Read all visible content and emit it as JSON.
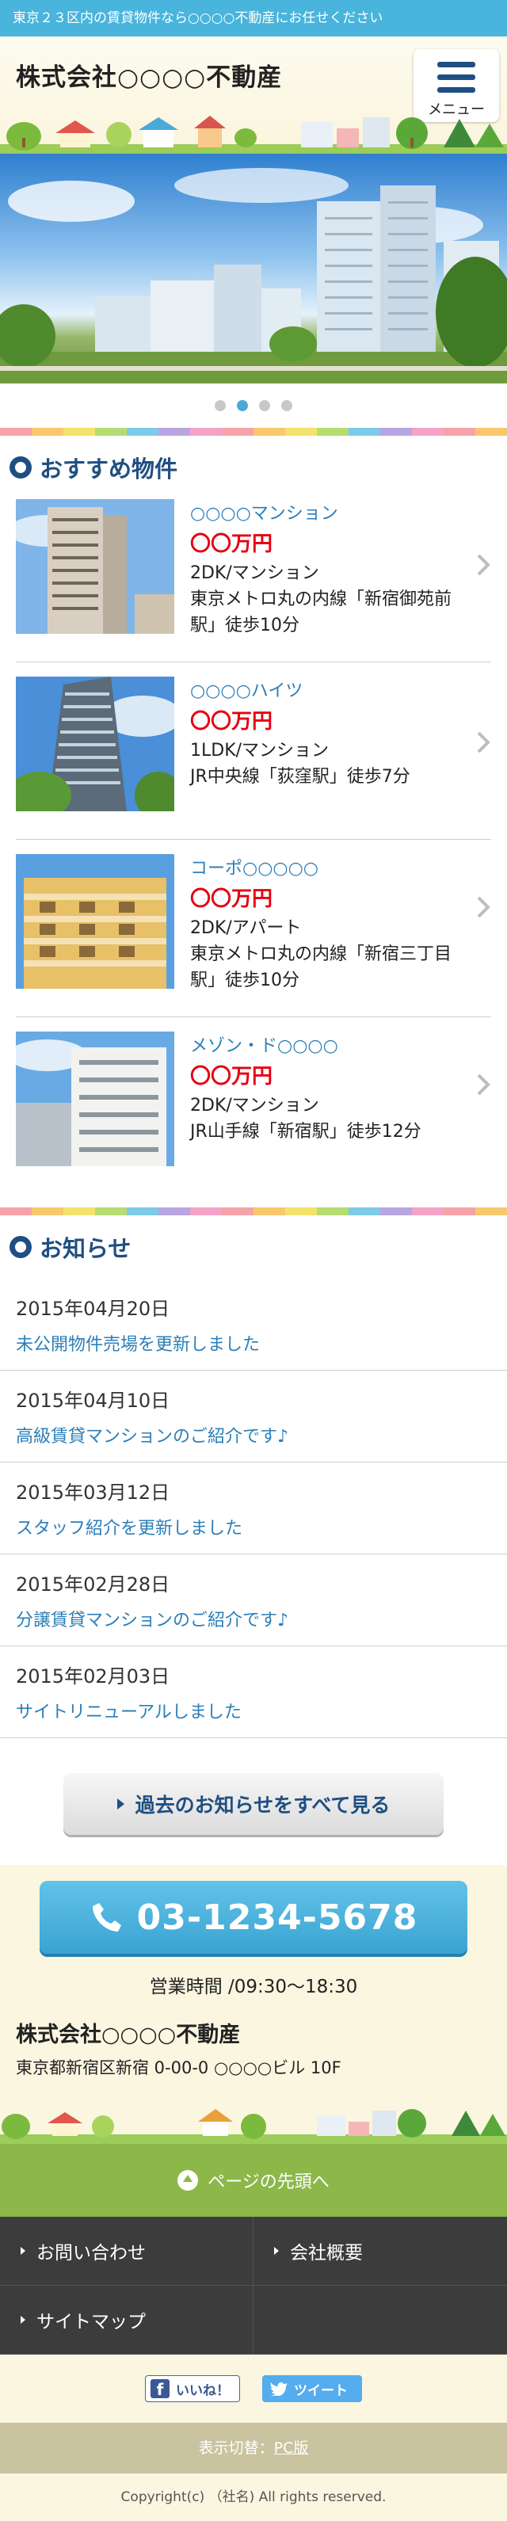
{
  "tagline": "東京２３区内の賃貸物件なら○○○○不動産にお任せください",
  "header": {
    "site_name": "株式会社○○○○不動産",
    "menu_label": "メニュー"
  },
  "slider": {
    "slide_count": 4,
    "active_index": 1
  },
  "recommended": {
    "title": "おすすめ物件",
    "items": [
      {
        "name": "○○○○マンション",
        "price": "〇〇万円",
        "type": "2DK/マンション",
        "access": "東京メトロ丸の内線「新宿御苑前駅」徒歩10分"
      },
      {
        "name": "○○○○ハイツ",
        "price": "〇〇万円",
        "type": "1LDK/マンション",
        "access": "JR中央線「荻窪駅」徒歩7分"
      },
      {
        "name": "コーポ○○○○○",
        "price": "〇〇万円",
        "type": "2DK/アパート",
        "access": "東京メトロ丸の内線「新宿三丁目駅」徒歩10分"
      },
      {
        "name": "メゾン・ド○○○○",
        "price": "〇〇万円",
        "type": "2DK/マンション",
        "access": "JR山手線「新宿駅」徒歩12分"
      }
    ]
  },
  "news": {
    "title": "お知らせ",
    "items": [
      {
        "date": "2015年04月20日",
        "text": "未公開物件売場を更新しました"
      },
      {
        "date": "2015年04月10日",
        "text": "高級賃貸マンションのご紹介です♪"
      },
      {
        "date": "2015年03月12日",
        "text": "スタッフ紹介を更新しました"
      },
      {
        "date": "2015年02月28日",
        "text": "分譲賃貸マンションのご紹介です♪"
      },
      {
        "date": "2015年02月03日",
        "text": "サイトリニューアルしました"
      }
    ],
    "more_label": "過去のお知らせをすべて見る"
  },
  "footer": {
    "tel": "03-1234-5678",
    "hours": "営業時間 /09:30〜18:30",
    "company": "株式会社○○○○不動産",
    "address": "東京都新宿区新宿 0-00-0 ○○○○ビル 10F",
    "to_top": "ページの先頭へ",
    "nav": [
      "お問い合わせ",
      "会社概要",
      "サイトマップ"
    ],
    "like": "いいね！",
    "tweet": "ツイート",
    "switch_prefix": "表示切替：",
    "switch_link": "PC版",
    "copyright": "Copyright(c) （社名) All rights reserved."
  },
  "colors": {
    "accent_blue": "#49b4dc",
    "navy": "#1f4f82",
    "price_red": "#e60012",
    "green": "#8cb84a"
  }
}
